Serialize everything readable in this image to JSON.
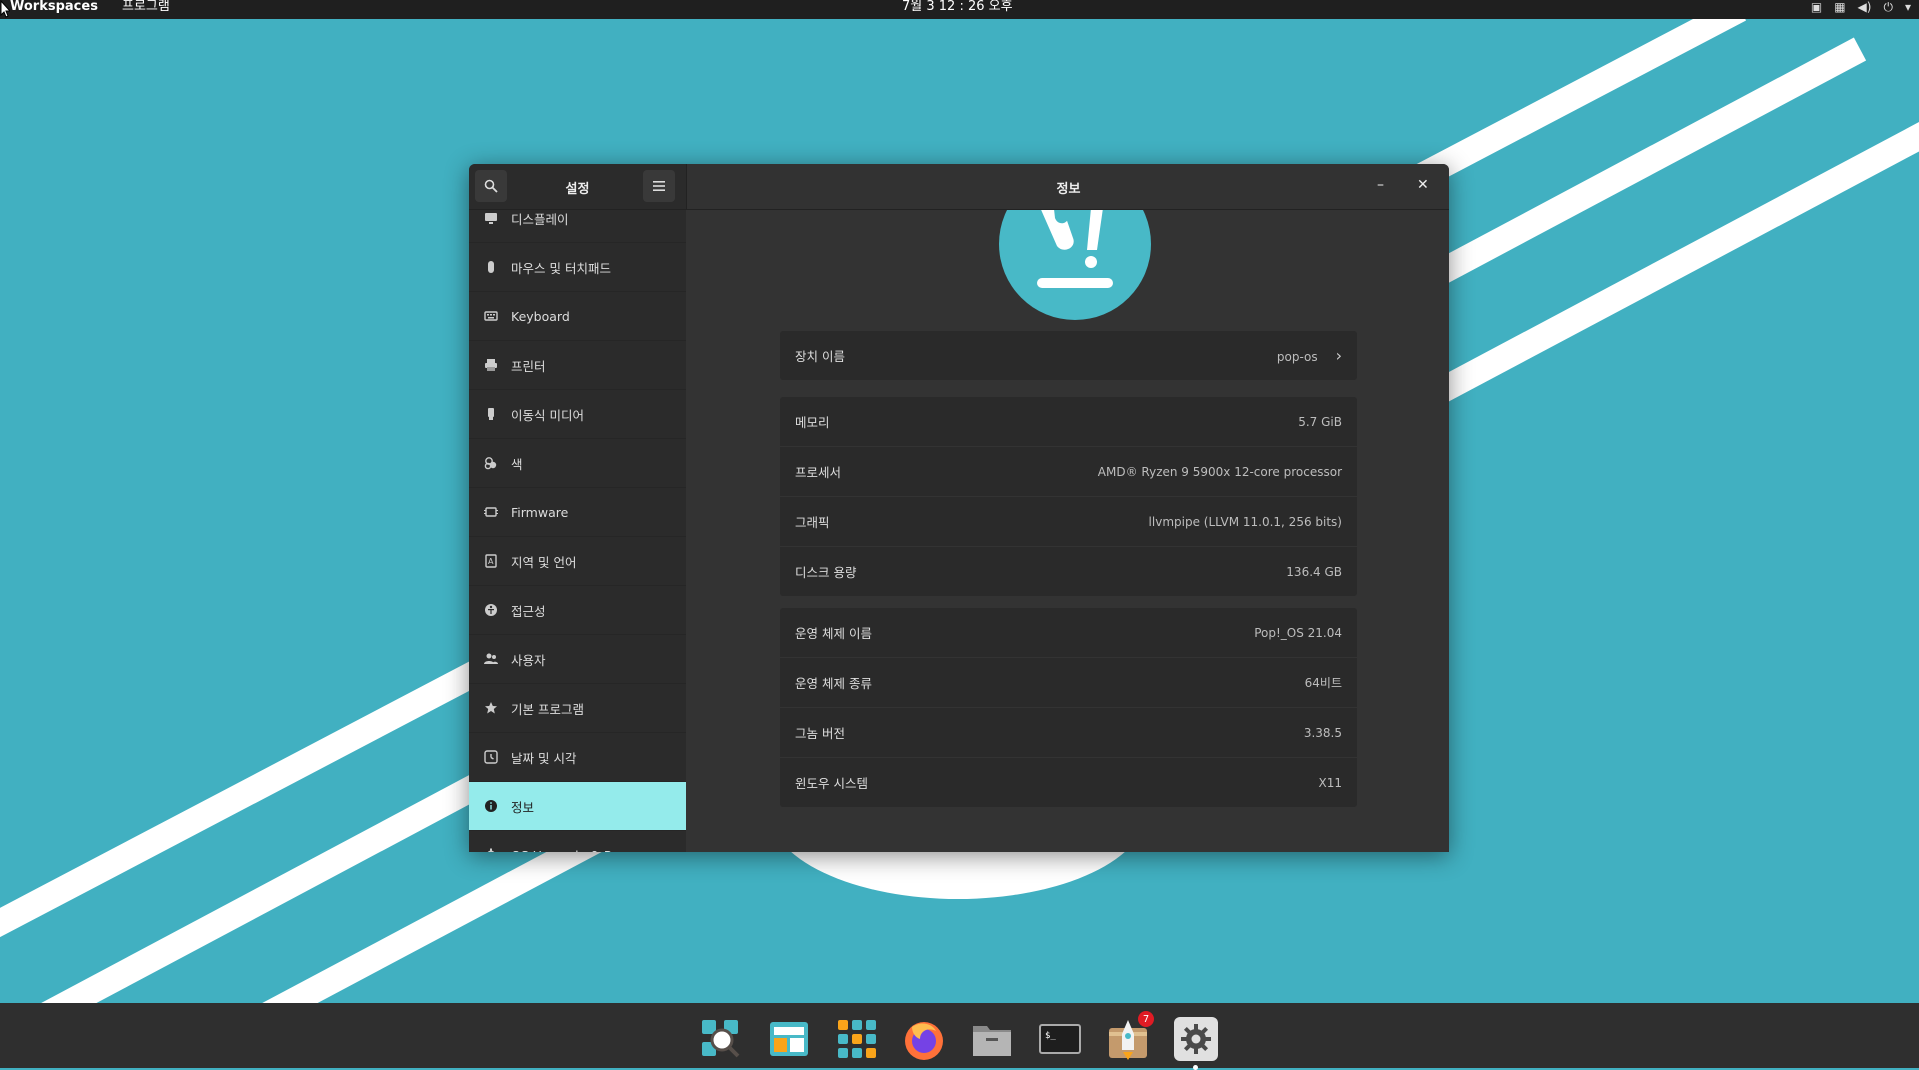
{
  "topbar": {
    "workspaces": "Workspaces",
    "applications": "프로그램",
    "clock": "7월 3 12 : 26 오후"
  },
  "window": {
    "sidebar_title": "설정",
    "main_title": "정보",
    "minimize": "–",
    "close": "✕"
  },
  "sidebar": {
    "items": [
      {
        "label": "디스플레이",
        "icon": "display-icon"
      },
      {
        "label": "마우스 및 터치패드",
        "icon": "mouse-icon"
      },
      {
        "label": "Keyboard",
        "icon": "keyboard-icon"
      },
      {
        "label": "프린터",
        "icon": "printer-icon"
      },
      {
        "label": "이동식 미디어",
        "icon": "usb-icon"
      },
      {
        "label": "색",
        "icon": "color-icon"
      },
      {
        "label": "Firmware",
        "icon": "chip-icon"
      },
      {
        "label": "지역 및 언어",
        "icon": "language-icon"
      },
      {
        "label": "접근성",
        "icon": "accessibility-icon"
      },
      {
        "label": "사용자",
        "icon": "users-icon"
      },
      {
        "label": "기본 프로그램",
        "icon": "star-icon"
      },
      {
        "label": "날짜 및 시각",
        "icon": "clock-icon"
      },
      {
        "label": "정보",
        "icon": "info-icon",
        "active": true
      },
      {
        "label": "OS Upgrade & Recovery",
        "icon": "gear-icon"
      }
    ]
  },
  "about": {
    "device_name_label": "장치 이름",
    "device_name_value": "pop-os",
    "memory_label": "메모리",
    "memory_value": "5.7 GiB",
    "processor_label": "프로세서",
    "processor_value": "AMD® Ryzen 9 5900x 12-core processor",
    "graphics_label": "그래픽",
    "graphics_value": "llvmpipe (LLVM 11.0.1, 256 bits)",
    "disk_label": "디스크 용량",
    "disk_value": "136.4 GB",
    "os_name_label": "운영 체제 이름",
    "os_name_value": "Pop!_OS 21.04",
    "os_type_label": "운영 체제 종류",
    "os_type_value": "64비트",
    "gnome_label": "그놈 버전",
    "gnome_value": "3.38.5",
    "windowing_label": "윈도우 시스템",
    "windowing_value": "X11"
  },
  "dock": {
    "items": [
      "search-app-icon",
      "workspaces-app-icon",
      "app-grid-icon",
      "firefox-icon",
      "files-icon",
      "terminal-icon",
      "pop-shop-icon",
      "settings-icon"
    ],
    "shop_badge": "7"
  },
  "colors": {
    "desktop_bg": "#41b0c1",
    "active_item": "#94ebeb",
    "window_bg": "#333333"
  }
}
